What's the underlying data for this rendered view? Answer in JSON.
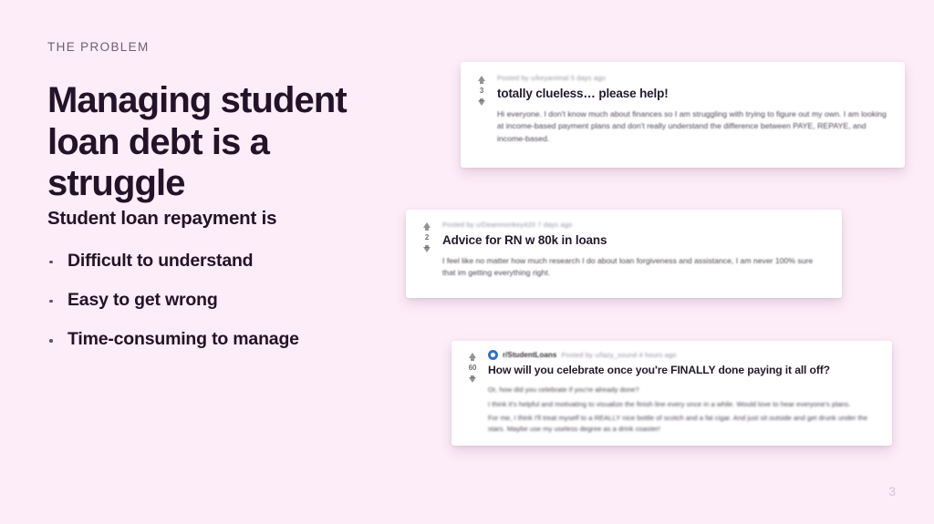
{
  "slide": {
    "background_color": "#fdedf8",
    "eyebrow": "THE PROBLEM",
    "headline": "Managing student loan debt is a struggle",
    "subhead": "Student loan repayment is",
    "page_number": "3",
    "text_color": "#241229",
    "accent_color": "#2f6fd0"
  },
  "bullets": [
    {
      "label": "Difficult to understand"
    },
    {
      "label": "Easy to get wrong"
    },
    {
      "label": "Time-consuming to manage"
    }
  ],
  "posts": [
    {
      "id": "post-1",
      "subreddit": "",
      "byline": "Posted by u/keyanimal 5 days ago",
      "score": "3",
      "title": "totally clueless… please help!",
      "paragraphs": [
        "Hi everyone. I don't know much about finances so I am struggling with trying to figure out my own. I am looking at income-based payment plans and don't really understand the difference between PAYE, REPAYE, and income-based."
      ]
    },
    {
      "id": "post-2",
      "subreddit": "",
      "byline": "Posted by u/Deanmonkey420 7 days ago",
      "score": "2",
      "title": "Advice for RN w 80k in loans",
      "paragraphs": [
        "I feel like no matter how much research I do about loan forgiveness and assistance, I am never 100% sure that im getting everything right."
      ]
    },
    {
      "id": "post-3",
      "subreddit": "r/StudentLoans",
      "byline": "Posted by u/lazy_sound 4 hours ago",
      "score": "60",
      "title": "How will you celebrate once you're FINALLY done paying it all off?",
      "paragraphs": [
        "Or, how did you celebrate if you're already done?",
        "I think it's helpful and motivating to visualize the finish line every once in a while. Would love to hear everyone's plans.",
        "For me, I think I'll treat myself to a REALLY nice bottle of scotch and a fat cigar. And just sit outside and get drunk under the stars. Maybe use my useless degree as a drink coaster!"
      ]
    }
  ]
}
